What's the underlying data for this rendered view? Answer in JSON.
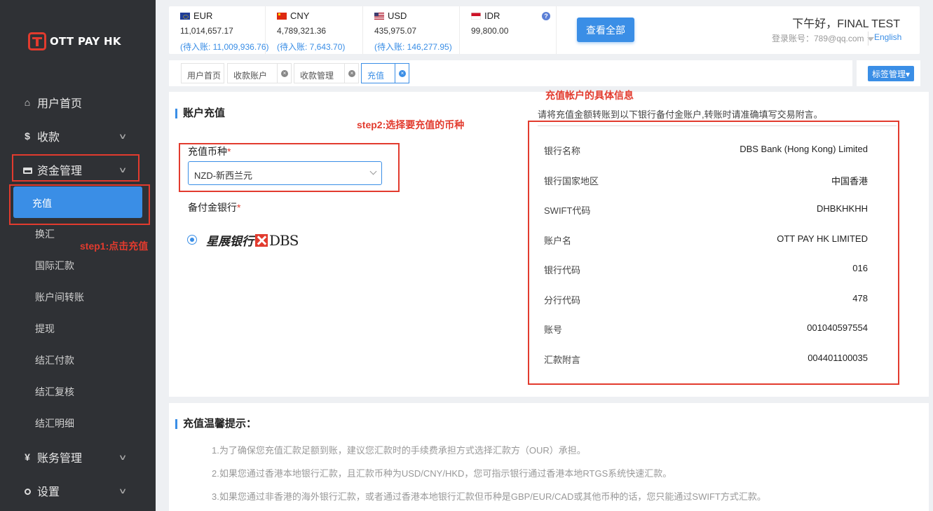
{
  "logo": {
    "text": "OTT PAY HK"
  },
  "sidebar": {
    "items": [
      {
        "label": "用户首页",
        "icon": "home-icon"
      },
      {
        "label": "收款",
        "icon": "dollar-icon"
      },
      {
        "label": "资金管理",
        "icon": "card-icon"
      },
      {
        "label": "账务管理",
        "icon": "yen-icon"
      },
      {
        "label": "设置",
        "icon": "search-icon"
      }
    ],
    "sub_items": [
      "充值",
      "换汇",
      "国际汇款",
      "账户间转账",
      "提现",
      "结汇付款",
      "结汇复核",
      "结汇明细"
    ]
  },
  "annotations": {
    "step1": "step1:点击充值",
    "step2": "step2:选择要充值的币种",
    "info_title": "充值帐户的具体信息"
  },
  "currencies": [
    {
      "code": "EUR",
      "amount": "11,014,657.17",
      "pending": "(待入账: 11,009,936.76)",
      "flag": "eu-flag-icon"
    },
    {
      "code": "CNY",
      "amount": "4,789,321.36",
      "pending": "(待入账: 7,643.70)",
      "flag": "cn-flag-icon"
    },
    {
      "code": "USD",
      "amount": "435,975.07",
      "pending": "(待入账: 146,277.95)",
      "flag": "us-flag-icon"
    },
    {
      "code": "IDR",
      "amount": "99,800.00",
      "pending": "",
      "flag": "id-flag-icon"
    }
  ],
  "header": {
    "help_icon": "?",
    "view_all": "查看全部",
    "greeting": "下午好，FINAL TEST",
    "login": "登录账号：789@qq.com",
    "language": "English"
  },
  "tabs": [
    {
      "label": "用户首页",
      "closable": false
    },
    {
      "label": "收款账户",
      "closable": true
    },
    {
      "label": "收款管理",
      "closable": true
    },
    {
      "label": "充值",
      "closable": true,
      "active": true
    }
  ],
  "tag_manage": "标签管理▾",
  "recharge": {
    "title": "账户充值",
    "currency_label": "充值币种",
    "required_mark": "*",
    "currency_value": "NZD-新西兰元",
    "bank_label": "备付金银行",
    "bank_name_cn": "星展银行",
    "bank_name_en": "DBS"
  },
  "account_info": {
    "note": "请将充值金额转账到以下银行备付金账户,转账时请准确填写交易附言。",
    "rows": [
      {
        "label": "银行名称",
        "value": "DBS Bank (Hong Kong) Limited"
      },
      {
        "label": "银行国家地区",
        "value": "中国香港"
      },
      {
        "label": "SWIFT代码",
        "value": "DHBKHKHH"
      },
      {
        "label": "账户名",
        "value": "OTT PAY HK LIMITED"
      },
      {
        "label": "银行代码",
        "value": "016"
      },
      {
        "label": "分行代码",
        "value": "478"
      },
      {
        "label": "账号",
        "value": "001040597554"
      },
      {
        "label": "汇款附言",
        "value": "004401100035"
      }
    ]
  },
  "tips": {
    "title": "充值温馨提示：",
    "items": [
      "1.为了确保您充值汇款足额到账，建议您汇款时的手续费承担方式选择汇款方（OUR）承担。",
      "2.如果您通过香港本地银行汇款，且汇款币种为USD/CNY/HKD，您可指示银行通过香港本地RTGS系统快速汇款。",
      "3.如果您通过非香港的海外银行汇款，或者通过香港本地银行汇款但币种是GBP/EUR/CAD或其他币种的话，您只能通过SWIFT方式汇款。"
    ]
  },
  "colors": {
    "accent": "#3a8ee6",
    "annotation": "#e23b2e",
    "sidebar": "#2f3135"
  }
}
